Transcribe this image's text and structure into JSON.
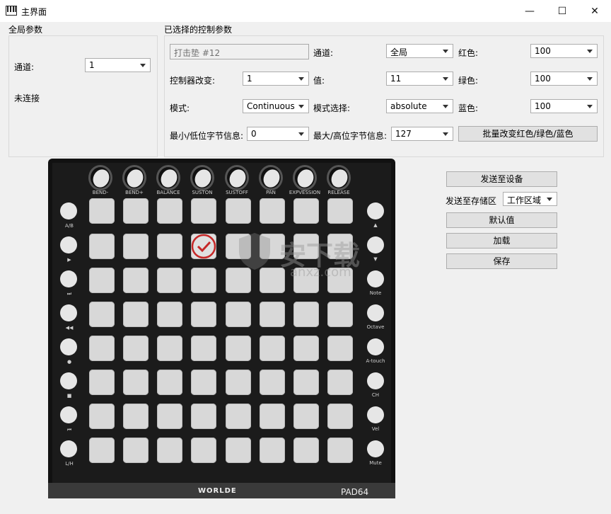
{
  "window": {
    "title": "主界面",
    "min": "—",
    "max": "☐",
    "close": "✕"
  },
  "global": {
    "group_label": "全局参数",
    "channel_label": "通道:",
    "channel_value": "1",
    "status": "未连接"
  },
  "selected": {
    "group_label": "已选择的控制参数",
    "pad_name": "打击垫 #12",
    "channel_label": "通道:",
    "channel_value": "全局",
    "red_label": "红色:",
    "red_value": "100",
    "controller_label": "控制器改变:",
    "controller_value": "1",
    "value_label": "值:",
    "value_value": "11",
    "green_label": "绿色:",
    "green_value": "100",
    "mode_label": "模式:",
    "mode_value": "Continuous",
    "mode_select_label": "模式选择:",
    "mode_select_value": "absolute",
    "blue_label": "蓝色:",
    "blue_value": "100",
    "min_label": "最小/低位字节信息:",
    "min_value": "0",
    "max_label": "最大/高位字节信息:",
    "max_value": "127",
    "batch_button": "批量改变红色/绿色/蓝色"
  },
  "actions": {
    "send_device": "发送至设备",
    "send_storage_label": "发送至存储区",
    "storage_value": "工作区域",
    "default": "默认值",
    "load": "加载",
    "save": "保存"
  },
  "device": {
    "knobs": [
      "BEND-",
      "BEND+",
      "BALANCE",
      "SUSTON",
      "SUSTOFF",
      "PAN",
      "EXPVESSION",
      "RELEASE"
    ],
    "left_buttons": [
      "A/B",
      "▶",
      "⏭",
      "◀◀",
      "●",
      "■",
      "⏮",
      "L/H"
    ],
    "right_buttons": [
      "▲",
      "▼",
      "Note",
      "Octave",
      "A-touch",
      "CH",
      "Vel",
      "Mute"
    ],
    "brand": "WORLDE",
    "model": "PAD64",
    "selected_pad": 12
  },
  "watermark": {
    "text": "安下载",
    "sub": "anxz.com"
  }
}
